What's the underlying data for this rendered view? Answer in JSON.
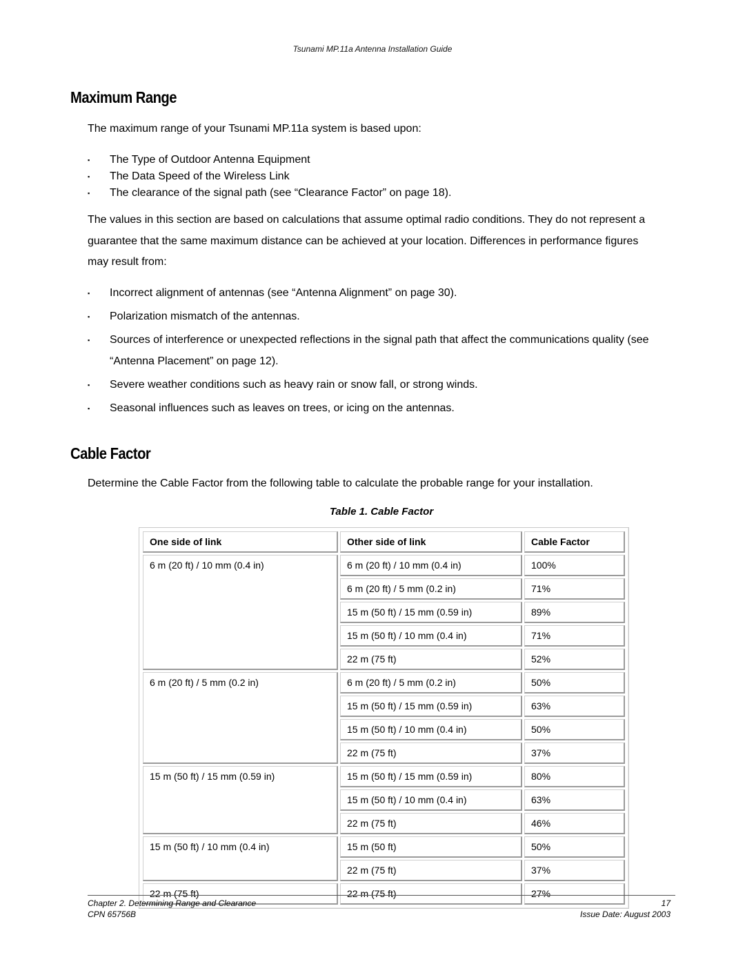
{
  "header": {
    "running_title": "Tsunami MP.11a Antenna Installation Guide"
  },
  "section_max_range": {
    "title": "Maximum Range",
    "intro": "The maximum range of your Tsunami MP.11a system is based upon:",
    "bullet_glyph": "▪",
    "factors": [
      "The Type of Outdoor Antenna Equipment",
      "The Data Speed of the Wireless Link",
      "The clearance of the signal path (see “Clearance Factor” on page 18)."
    ],
    "disclaimer": "The values in this section are based on calculations that assume optimal radio conditions.  They do not represent a guarantee that the same maximum distance can be achieved at your location. Differences in performance figures may result from:",
    "differences": [
      "Incorrect alignment of antennas (see “Antenna Alignment” on page 30).",
      "Polarization mismatch of the antennas.",
      "Sources of interference or unexpected reflections in the signal path that affect the communications quality (see “Antenna Placement” on page 12).",
      "Severe weather conditions such as heavy rain or snow fall, or strong winds.",
      "Seasonal influences such as leaves on trees, or icing on the antennas."
    ]
  },
  "section_cable_factor": {
    "title": "Cable Factor",
    "intro": "Determine the Cable Factor from the following table to calculate the probable range for your installation.",
    "table_caption": "Table 1.  Cable Factor",
    "columns": [
      "One side of link",
      "Other side of link",
      "Cable Factor"
    ],
    "groups": [
      {
        "one_side": "6 m (20 ft) / 10 mm (0.4 in)",
        "rows": [
          {
            "other_side": "6 m (20 ft) / 10 mm (0.4 in)",
            "factor": "100%"
          },
          {
            "other_side": "6 m (20 ft) / 5 mm (0.2 in)",
            "factor": "71%"
          },
          {
            "other_side": "15 m (50 ft) / 15 mm (0.59 in)",
            "factor": "89%"
          },
          {
            "other_side": "15 m (50 ft) / 10 mm (0.4 in)",
            "factor": "71%"
          },
          {
            "other_side": "22 m (75 ft)",
            "factor": "52%"
          }
        ]
      },
      {
        "one_side": "6 m (20 ft) / 5 mm (0.2 in)",
        "rows": [
          {
            "other_side": "6 m (20 ft) / 5 mm (0.2 in)",
            "factor": "50%"
          },
          {
            "other_side": "15 m (50 ft) / 15 mm (0.59 in)",
            "factor": "63%"
          },
          {
            "other_side": "15 m (50 ft) / 10 mm (0.4 in)",
            "factor": "50%"
          },
          {
            "other_side": "22 m (75 ft)",
            "factor": "37%"
          }
        ]
      },
      {
        "one_side": "15 m (50 ft) / 15 mm (0.59 in)",
        "rows": [
          {
            "other_side": "15 m (50 ft) / 15 mm (0.59 in)",
            "factor": "80%"
          },
          {
            "other_side": "15 m (50 ft) / 10 mm (0.4 in)",
            "factor": "63%"
          },
          {
            "other_side": "22 m (75 ft)",
            "factor": "46%"
          }
        ]
      },
      {
        "one_side": "15 m (50 ft) / 10 mm (0.4 in)",
        "rows": [
          {
            "other_side": "15 m (50 ft)",
            "factor": "50%"
          },
          {
            "other_side": "22 m (75 ft)",
            "factor": "37%"
          }
        ]
      },
      {
        "one_side": "22 m (75 ft)",
        "rows": [
          {
            "other_side": "22 m (75 ft)",
            "factor": "27%"
          }
        ]
      }
    ]
  },
  "footer": {
    "chapter": "Chapter 2.  Determining Range and Clearance",
    "page_number": "17",
    "cpn": "CPN 65756B",
    "issue_date": "Issue Date:  August 2003"
  }
}
